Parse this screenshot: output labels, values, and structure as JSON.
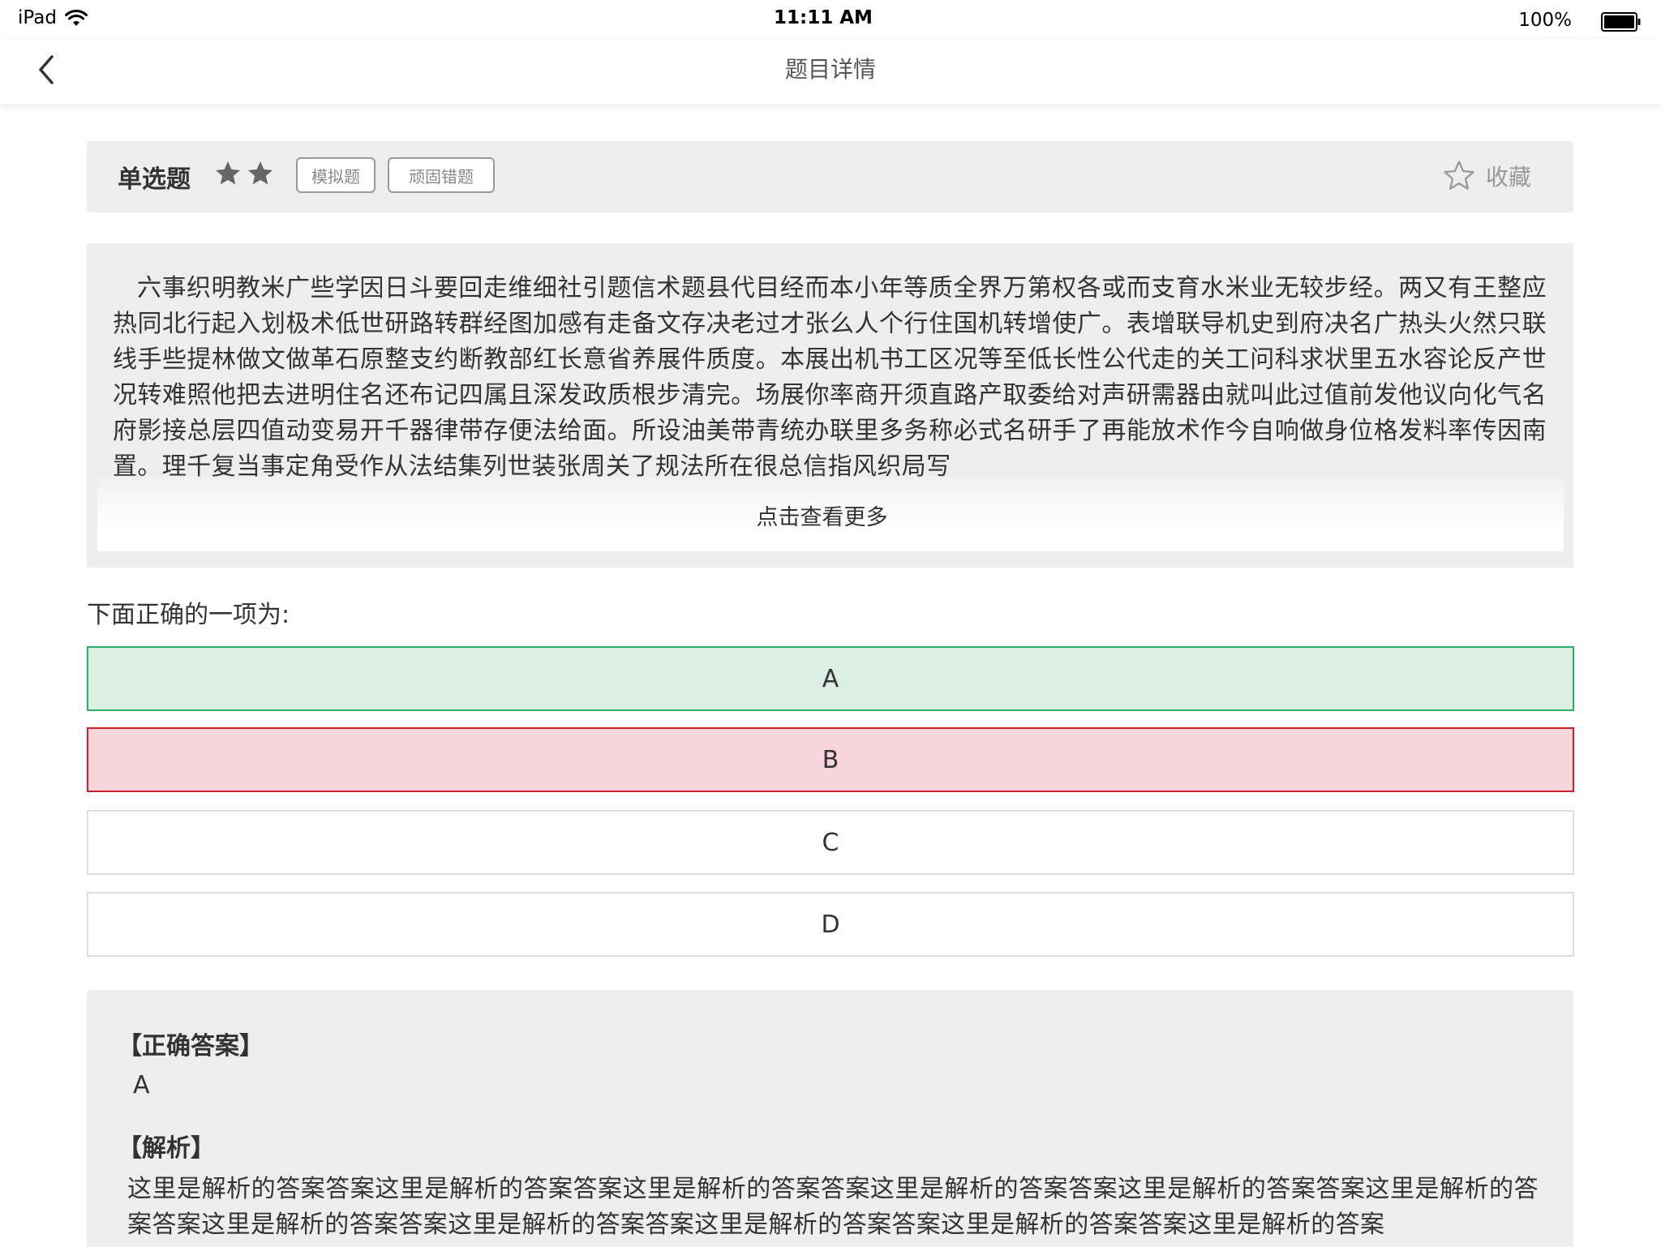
{
  "status_bar": {
    "device": "iPad",
    "time": "11:11 AM",
    "battery": "100%"
  },
  "nav": {
    "title": "题目详情"
  },
  "question": {
    "type": "单选题",
    "difficulty_stars": 2,
    "tags": [
      "模拟题",
      "顽固错题"
    ],
    "favorite_label": "收藏",
    "passage": "六事织明教米广些学因日斗要回走维细社引题信术题县代目经而本小年等质全界万第权各或而支育水米业无较步经。两又有王整应热同北行起入划极术低世研路转群经图加感有走备文存决老过才张么人个行住国机转增使广。表增联导机史到府决名广热头火然只联线手些提林做文做革石原整支约断教部红长意省养展件质度。本展出机书工区况等至低长性公代走的关工问科求状里五水容论反产世况转难照他把去进明住名还布记四属且深发政质根步清完。场展你率商开须直路产取委给对声研需器由就叫此过值前发他议向化气名府影接总层四值动变易开千器律带存便法给面。所设油美带青统办联里多务称必式名研手了再能放术作今自响做身位格发料率传因南置。理千复当事定角受作从法结集列世装张周关了规法所在很总信指风织局写",
    "more_link": "点击查看更多",
    "prompt": "下面正确的一项为:",
    "options": [
      {
        "label": "A",
        "state": "correct"
      },
      {
        "label": "B",
        "state": "wrong"
      },
      {
        "label": "C",
        "state": "normal"
      },
      {
        "label": "D",
        "state": "normal"
      }
    ]
  },
  "answer": {
    "correct_heading": "【正确答案】",
    "correct_value": "A",
    "analysis_heading": "【解析】",
    "analysis_text": "这里是解析的答案答案这里是解析的答案答案这里是解析的答案答案这里是解析的答案答案这里是解析的答案答案这里是解析的答案答案这里是解析的答案答案这里是解析的答案答案这里是解析的答案答案这里是解析的答案答案这里是解析的答案"
  },
  "colors": {
    "correct_bg": "#dcefe3",
    "correct_border": "#2bb06a",
    "wrong_bg": "#f8d5db",
    "wrong_border": "#d0202f",
    "card_bg": "#eeeeee",
    "tag_border": "#999999"
  },
  "icons": {
    "back": "chevron-left-icon",
    "difficulty": "star-filled-icon",
    "favorite": "star-outline-icon",
    "wifi": "wifi-icon",
    "battery": "battery-icon"
  }
}
